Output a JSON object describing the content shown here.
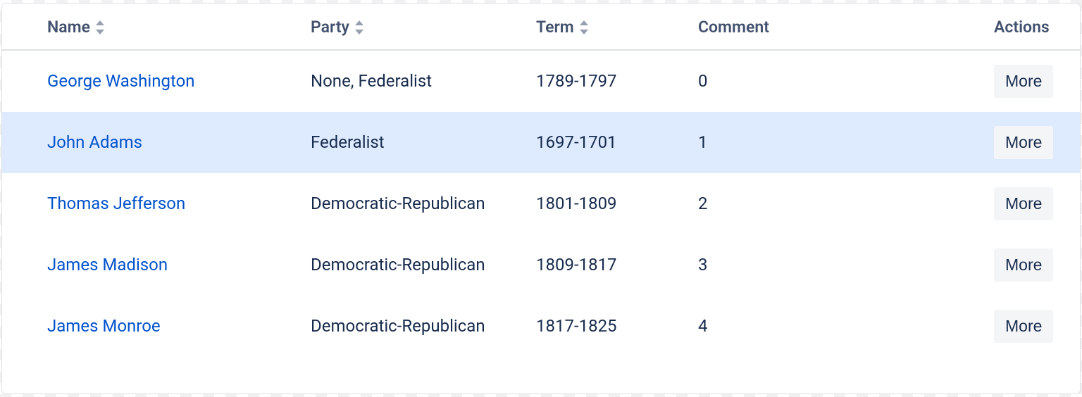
{
  "columns": {
    "name": "Name",
    "party": "Party",
    "term": "Term",
    "comment": "Comment",
    "actions": "Actions"
  },
  "actions": {
    "more_label": "More"
  },
  "rows": [
    {
      "name": "George Washington",
      "party": "None, Federalist",
      "term": "1789-1797",
      "comment": "0",
      "highlight": false
    },
    {
      "name": "John Adams",
      "party": "Federalist",
      "term": "1697-1701",
      "comment": "1",
      "highlight": true
    },
    {
      "name": "Thomas Jefferson",
      "party": "Democratic-Republican",
      "term": "1801-1809",
      "comment": "2",
      "highlight": false
    },
    {
      "name": "James Madison",
      "party": "Democratic-Republican",
      "term": "1809-1817",
      "comment": "3",
      "highlight": false
    },
    {
      "name": "James Monroe",
      "party": "Democratic-Republican",
      "term": "1817-1825",
      "comment": "4",
      "highlight": false
    }
  ]
}
